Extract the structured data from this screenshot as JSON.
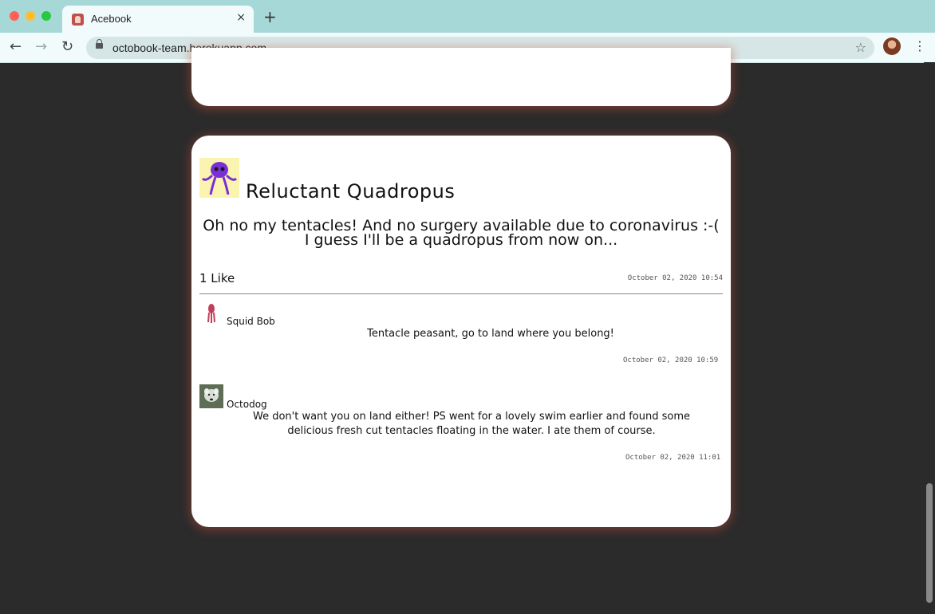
{
  "browser": {
    "tab_title": "Acebook",
    "tab_close": "×",
    "new_tab": "+",
    "url": "octobook-team.herokuapp.com",
    "back": "←",
    "forward": "→",
    "reload": "↻",
    "star": "☆",
    "menu": "⋮"
  },
  "post": {
    "author": "Reluctant Quadropus",
    "body": "Oh no my tentacles! And no surgery available due to coronavirus :-( I guess I'll be a quadropus from now on...",
    "likes": "1 Like",
    "date": "October 02, 2020 10:54",
    "comments": [
      {
        "author": "Squid Bob",
        "body": "Tentacle peasant, go to land where you belong!",
        "date": "October 02, 2020 10:59"
      },
      {
        "author": "Octodog",
        "body": "We don't want you on land either! PS went for a lovely swim earlier and found some delicious fresh cut tentacles floating in the water. I ate them of course.",
        "date": "October 02, 2020 11:01"
      }
    ]
  },
  "colors": {
    "page_bg": "#2b2b2b",
    "tabbar_bg": "#a7d8d8",
    "card_glow": "#c8503c"
  }
}
